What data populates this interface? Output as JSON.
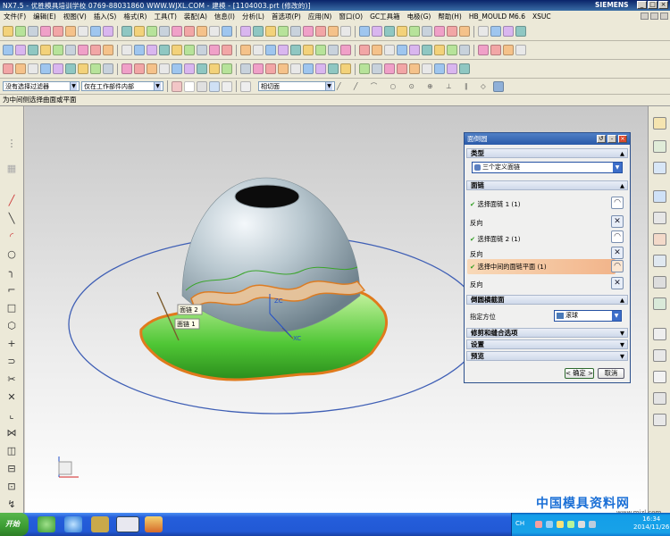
{
  "window": {
    "title": "NX7.5 - 优胜模具培训学校 0769-88031860 WWW.WJXL.COM - 建模 - [1104003.prt (修改的)]",
    "brand": "SIEMENS",
    "btn_min": "_",
    "btn_max": "□",
    "btn_close": "×"
  },
  "menu": [
    {
      "label": "文件(F)"
    },
    {
      "label": "编辑(E)"
    },
    {
      "label": "视图(V)"
    },
    {
      "label": "插入(S)"
    },
    {
      "label": "格式(R)"
    },
    {
      "label": "工具(T)"
    },
    {
      "label": "装配(A)"
    },
    {
      "label": "信息(I)"
    },
    {
      "label": "分析(L)"
    },
    {
      "label": "首选项(P)"
    },
    {
      "label": "应用(N)"
    },
    {
      "label": "窗口(O)"
    },
    {
      "label": "GC工具箱"
    },
    {
      "label": "电极(G)"
    },
    {
      "label": "帮助(H)"
    },
    {
      "label": "HB_MOULD M6.6"
    },
    {
      "label": "XSUC"
    }
  ],
  "selection_bar": {
    "filter_value": "没有选择过滤器",
    "scope_value": "仅在工作部件内部",
    "rule_value": "相切面"
  },
  "cue_line": "为中间侧选择曲面或平面",
  "viewport": {
    "label_face_2": "面链 2",
    "label_face_1": "面链 1",
    "axis_z": "ZC",
    "axis_x": "XC"
  },
  "dialog": {
    "title": "面倒圆",
    "btn_reset": "↺",
    "btn_min": "-",
    "btn_close": "×",
    "type_section": "类型",
    "type_value": "三个定义面链",
    "facechain_section": "面链",
    "select_face_1": "选择面链 1 (1)",
    "reverse_1": "反向",
    "select_face_2": "选择面链 2 (1)",
    "reverse_2": "反向",
    "select_middle": "选择中间的面链平面 (1)",
    "reverse_3": "反向",
    "cross_section": "倒圆横截面",
    "orient_label": "指定方位",
    "orient_value": "滚球",
    "trim_section": "修剪和缝合选项",
    "settings_section": "设置",
    "preview_section": "预览",
    "ok": "< 确定 >",
    "cancel": "取消"
  },
  "taskbar": {
    "start": "开始",
    "lang": "CH",
    "time": "16:34",
    "date": "2014/11/26"
  },
  "watermark": {
    "text": "中国模具资料网",
    "url": "www.mjzl.com"
  }
}
